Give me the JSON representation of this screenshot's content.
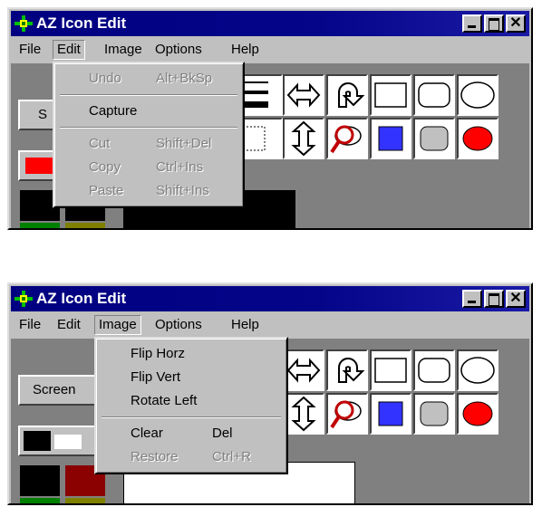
{
  "windows": [
    {
      "title": "AZ Icon Edit",
      "menubar": [
        "File",
        "Edit",
        "Image",
        "Options",
        "Help"
      ],
      "open_menu": "Edit",
      "screen_button": "S",
      "menu_items": [
        {
          "label": "Undo",
          "shortcut": "Alt+BkSp",
          "enabled": false
        },
        {
          "separator": true
        },
        {
          "label": "Capture",
          "shortcut": "",
          "enabled": true
        },
        {
          "separator": true
        },
        {
          "label": "Cut",
          "shortcut": "Shift+Del",
          "enabled": false
        },
        {
          "label": "Copy",
          "shortcut": "Ctrl+Ins",
          "enabled": false
        },
        {
          "label": "Paste",
          "shortcut": "Shift+Ins",
          "enabled": false
        }
      ]
    },
    {
      "title": "AZ Icon Edit",
      "menubar": [
        "File",
        "Edit",
        "Image",
        "Options",
        "Help"
      ],
      "open_menu": "Image",
      "screen_button": "Screen",
      "menu_items": [
        {
          "label": "Flip Horz",
          "shortcut": "",
          "enabled": true
        },
        {
          "label": "Flip Vert",
          "shortcut": "",
          "enabled": true
        },
        {
          "label": "Rotate Left",
          "shortcut": "",
          "enabled": true
        },
        {
          "separator": true
        },
        {
          "label": "Clear",
          "shortcut": "Del",
          "enabled": true
        },
        {
          "label": "Restore",
          "shortcut": "Ctrl+R",
          "enabled": false
        }
      ]
    }
  ],
  "colors": {
    "titlebar": "#000080",
    "face": "#c0c0c0",
    "fill_blue": "#3333ff",
    "fill_red": "#ff0000",
    "palette_red": "#ff0000",
    "palette_darkred": "#8b0000",
    "palette_green": "#008000",
    "palette_olive": "#808000"
  }
}
